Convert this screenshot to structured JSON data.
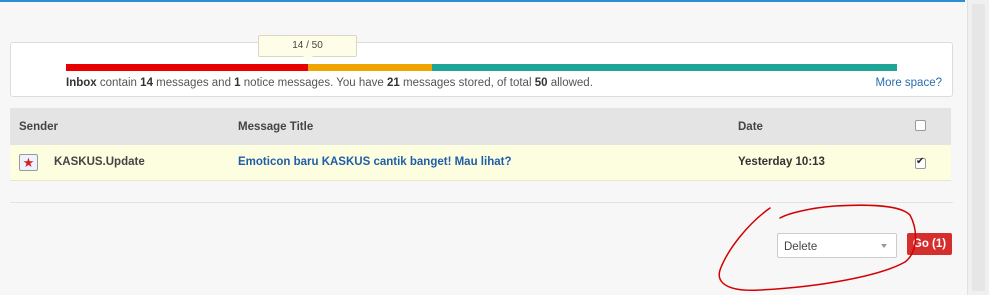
{
  "quota": {
    "tooltip": "14 / 50",
    "text": {
      "folder": "Inbox",
      "contain": "contain",
      "messages_count": "14",
      "messages_and": "messages and",
      "notice_count": "1",
      "notice_text": "notice messages. You have",
      "stored_count": "21",
      "stored_text": "messages stored, of total",
      "total": "50",
      "allowed": "allowed."
    },
    "more_space": "More space?",
    "levels": {
      "used": 14,
      "stored": 21,
      "total": 50
    },
    "colors": {
      "used": "#e80000",
      "stored": "#f0a400",
      "free": "#1ea596"
    }
  },
  "table": {
    "columns": [
      "Sender",
      "Message Title",
      "Date"
    ],
    "rows": [
      {
        "sender": "KASKUS.Update",
        "avatar_icon": "kaskus-avatar-icon",
        "title": "Emoticon baru KASKUS cantik banget! Mau lihat?",
        "date": "Yesterday 10:13",
        "checked": true
      }
    ]
  },
  "actions": {
    "selected": "Delete",
    "go_label": "Go (1)"
  },
  "colors": {
    "accent": "#2a8fd4",
    "go_button": "#d62d2d",
    "link": "#1e5ea8",
    "row_highlight": "#fdfde0",
    "annotation": "#d40000"
  }
}
